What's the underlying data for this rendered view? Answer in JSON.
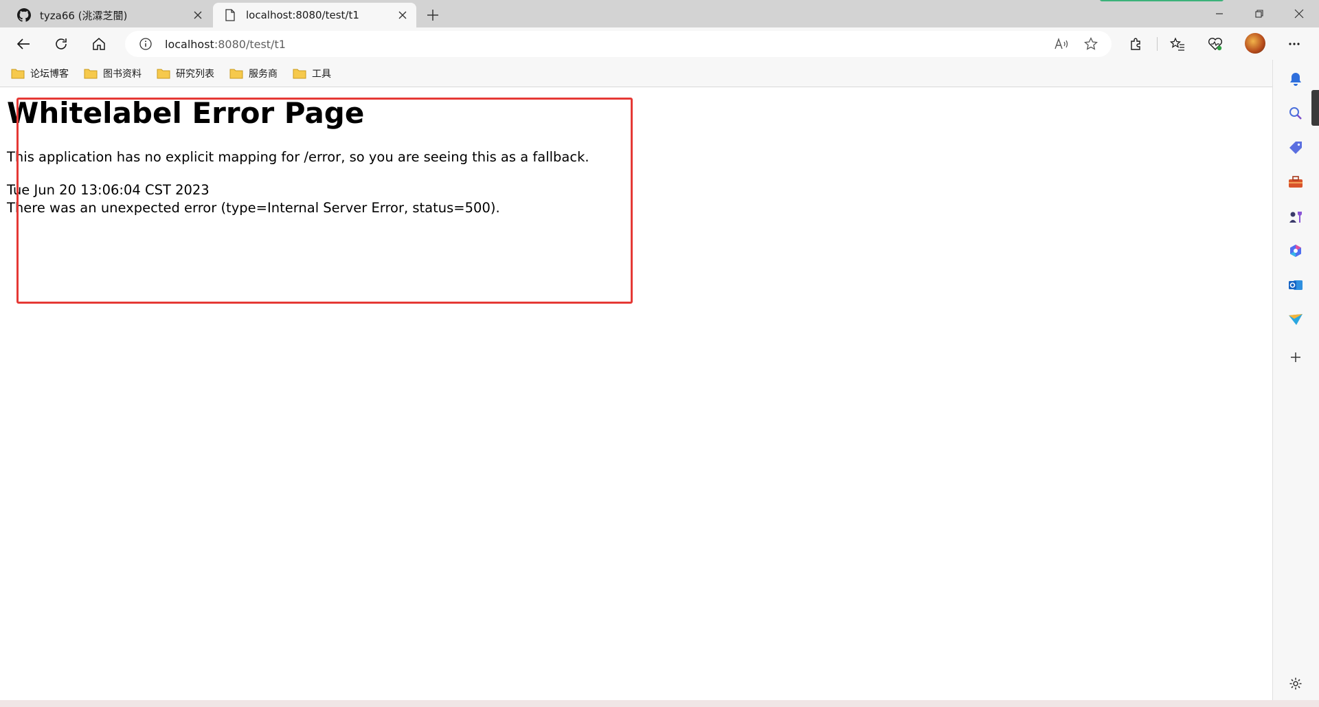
{
  "tabs": [
    {
      "title": "tyza66 (洮瀮芝闓)",
      "icon": "github-icon",
      "active": false
    },
    {
      "title": "localhost:8080/test/t1",
      "icon": "page-icon",
      "active": true
    }
  ],
  "address": {
    "host": "localhost",
    "path": ":8080/test/t1"
  },
  "bookmarks": [
    {
      "label": "论坛博客",
      "icon": "folder-icon"
    },
    {
      "label": "图书资料",
      "icon": "folder-icon"
    },
    {
      "label": "研究列表",
      "icon": "folder-icon"
    },
    {
      "label": "服务商",
      "icon": "folder-icon"
    },
    {
      "label": "工具",
      "icon": "folder-icon"
    }
  ],
  "page": {
    "title": "Whitelabel Error Page",
    "message": "This application has no explicit mapping for /error, so you are seeing this as a fallback.",
    "timestamp": "Tue Jun 20 13:06:04 CST 2023",
    "error": "There was an unexpected error (type=Internal Server Error, status=500)."
  },
  "colors": {
    "annotation": "#e53935",
    "folder": "#f6c94c"
  }
}
